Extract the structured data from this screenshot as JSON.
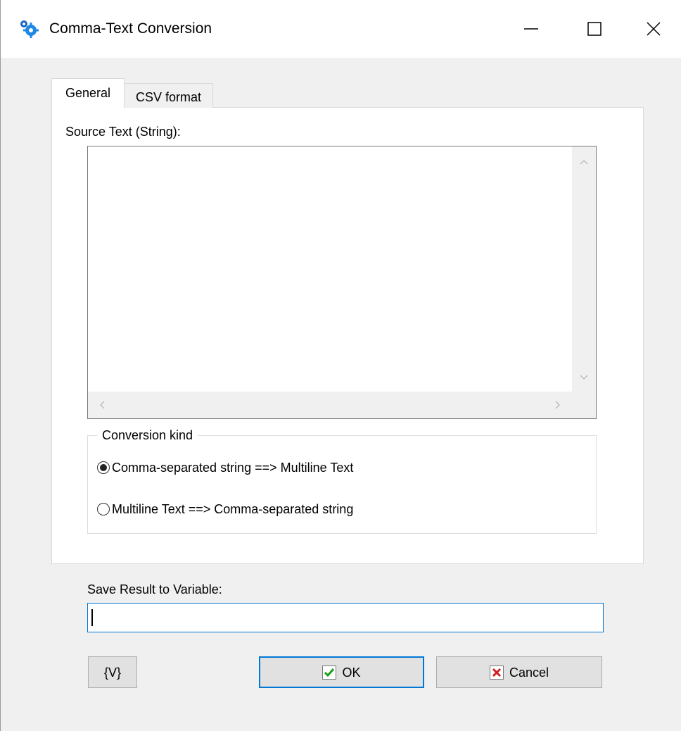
{
  "window": {
    "title": "Comma-Text Conversion"
  },
  "tabs": [
    {
      "label": "General",
      "active": true
    },
    {
      "label": "CSV format",
      "active": false
    }
  ],
  "general": {
    "source_label": "Source Text (String):",
    "source_value": "",
    "conversion_group_title": "Conversion kind",
    "conversion_options": [
      {
        "label": "Comma-separated string ==> Multiline Text",
        "selected": true
      },
      {
        "label": "Multiline Text ==> Comma-separated string",
        "selected": false
      }
    ]
  },
  "save_result": {
    "label": "Save Result to Variable:",
    "value": ""
  },
  "buttons": {
    "variables_label": "{V}",
    "ok_label": "OK",
    "cancel_label": "Cancel"
  },
  "colors": {
    "accent": "#0078d7",
    "ok_check": "#1a9e1a",
    "cancel_x": "#d21f1f",
    "app_icon": "#1e88e5"
  },
  "icons": {
    "app": "gears-icon",
    "minimize": "minimize-icon",
    "maximize": "maximize-icon",
    "close": "close-icon",
    "ok": "checkmark-icon",
    "cancel": "x-icon"
  }
}
